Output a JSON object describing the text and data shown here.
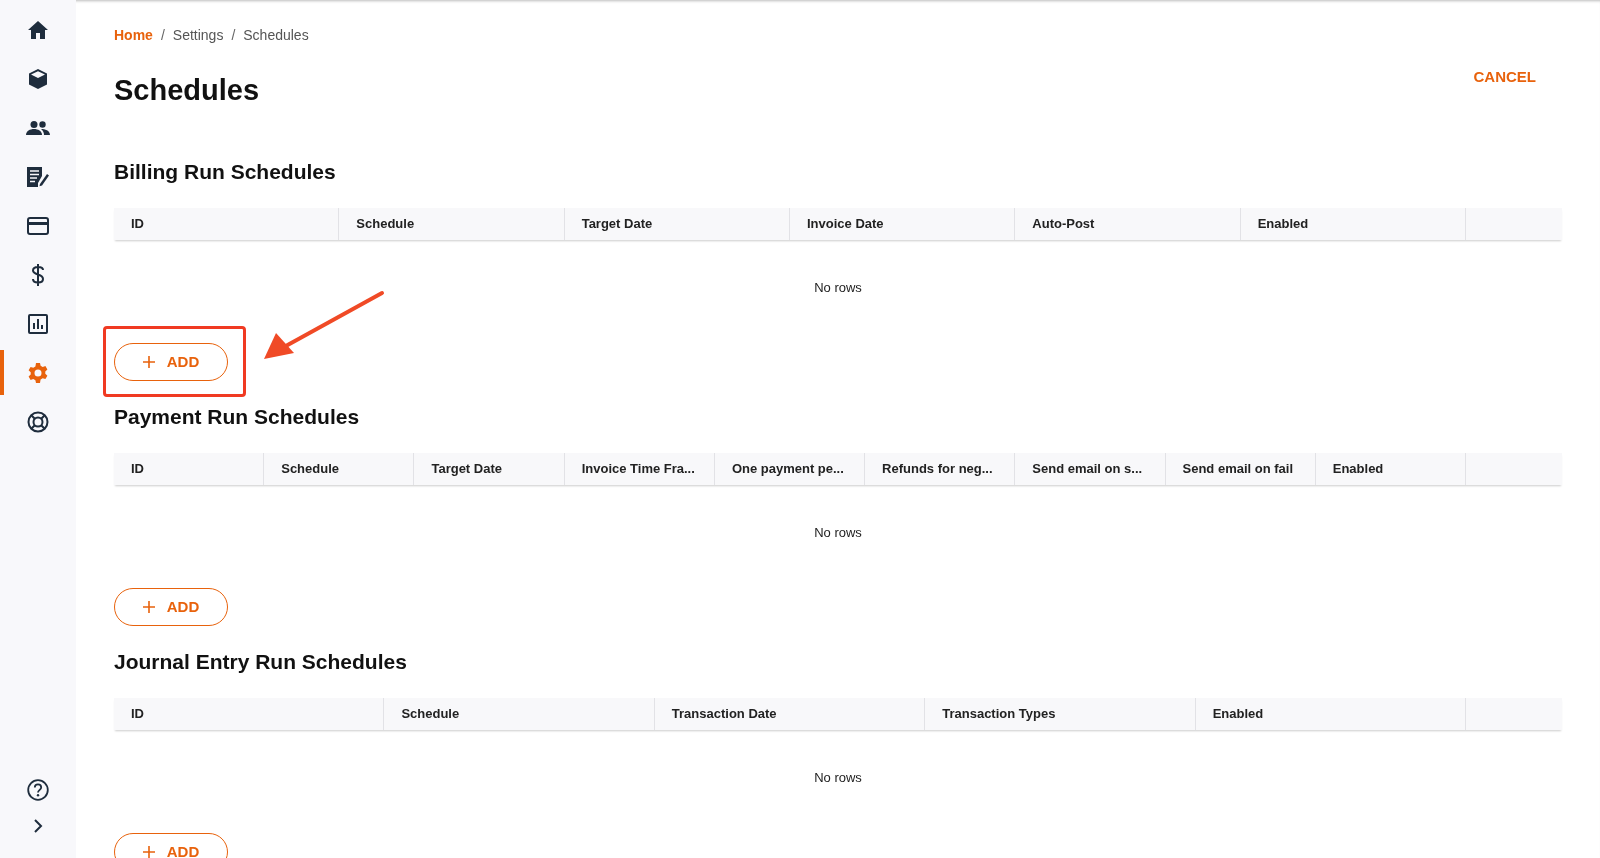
{
  "sidebar": {
    "items": [
      {
        "kind": "home",
        "selected": false
      },
      {
        "kind": "cube",
        "selected": false
      },
      {
        "kind": "people",
        "selected": false
      },
      {
        "kind": "document",
        "selected": false
      },
      {
        "kind": "card",
        "selected": false
      },
      {
        "kind": "dollar",
        "selected": false
      },
      {
        "kind": "chart",
        "selected": false
      },
      {
        "kind": "gear",
        "selected": true
      },
      {
        "kind": "lifebuoy",
        "selected": false
      }
    ],
    "footer": [
      {
        "kind": "help"
      },
      {
        "kind": "expand"
      }
    ]
  },
  "breadcrumb_separator": "/",
  "breadcrumb": [
    {
      "label": "Home",
      "link": true
    },
    {
      "label": "Settings",
      "link": false
    },
    {
      "label": "Schedules",
      "link": false
    }
  ],
  "title": "Schedules",
  "cancel": "CANCEL",
  "sections": [
    {
      "title": "Billing Run Schedules",
      "columns": [
        "ID",
        "Schedule",
        "Target Date",
        "Invoice Date",
        "Auto-Post",
        "Enabled"
      ],
      "empty": "No rows",
      "add": "ADD",
      "highlighted": true
    },
    {
      "title": "Payment Run Schedules",
      "columns": [
        "ID",
        "Schedule",
        "Target Date",
        "Invoice Time Fra...",
        "One payment pe...",
        "Refunds for neg...",
        "Send email on s...",
        "Send email on fail",
        "Enabled"
      ],
      "empty": "No rows",
      "add": "ADD",
      "highlighted": false
    },
    {
      "title": "Journal Entry Run Schedules",
      "columns": [
        "ID",
        "Schedule",
        "Transaction Date",
        "Transaction Types",
        "Enabled"
      ],
      "empty": "No rows",
      "add": "ADD",
      "highlighted": false
    }
  ]
}
